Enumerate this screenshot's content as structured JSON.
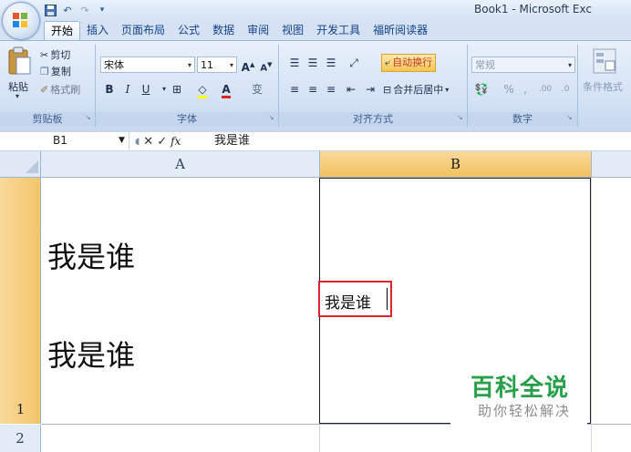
{
  "window": {
    "title": "Book1 - Microsoft Exc"
  },
  "quick_access": [
    {
      "name": "save-icon",
      "glyph": "▣"
    },
    {
      "name": "undo-icon",
      "glyph": "↶"
    },
    {
      "name": "redo-icon",
      "glyph": "↷"
    },
    {
      "name": "customize-icon",
      "glyph": "⚌"
    }
  ],
  "tabs": [
    "开始",
    "插入",
    "页面布局",
    "公式",
    "数据",
    "审阅",
    "视图",
    "开发工具",
    "福昕阅读器"
  ],
  "active_tab": "开始",
  "ribbon": {
    "clipboard": {
      "paste": "粘贴",
      "cut": "剪切",
      "copy": "复制",
      "format_painter": "格式刷",
      "label": "剪贴板"
    },
    "font": {
      "name": "宋体",
      "size": "11",
      "bold": "B",
      "italic": "I",
      "underline": "U",
      "font_color": "A",
      "phonetic": "变",
      "label": "字体"
    },
    "alignment": {
      "wrap_text": "自动换行",
      "merge_center": "合并后居中",
      "label": "对齐方式"
    },
    "number": {
      "format": "常规",
      "percent": "%",
      "comma": ",",
      "inc_dec": ".00",
      "label": "数字"
    },
    "styles": {
      "conditional": "条件格式"
    }
  },
  "formula_bar": {
    "cell_ref": "B1",
    "cancel": "✕",
    "enter": "✓",
    "fx": "fx",
    "content": "我是谁"
  },
  "sheet": {
    "columns": [
      "A",
      "B"
    ],
    "rows": [
      "1",
      "2"
    ],
    "selected_column": "B",
    "cells": {
      "A1": "我是谁\n\n我是谁",
      "B1": "我是谁"
    }
  },
  "watermark": {
    "title": "百科全说",
    "subtitle": "助你轻松解决"
  },
  "colors": {
    "selection_header": "#f2c56a",
    "edit_border": "#d9272e",
    "ribbon": "#d5e3f5",
    "watermark_green": "#27a04a"
  }
}
